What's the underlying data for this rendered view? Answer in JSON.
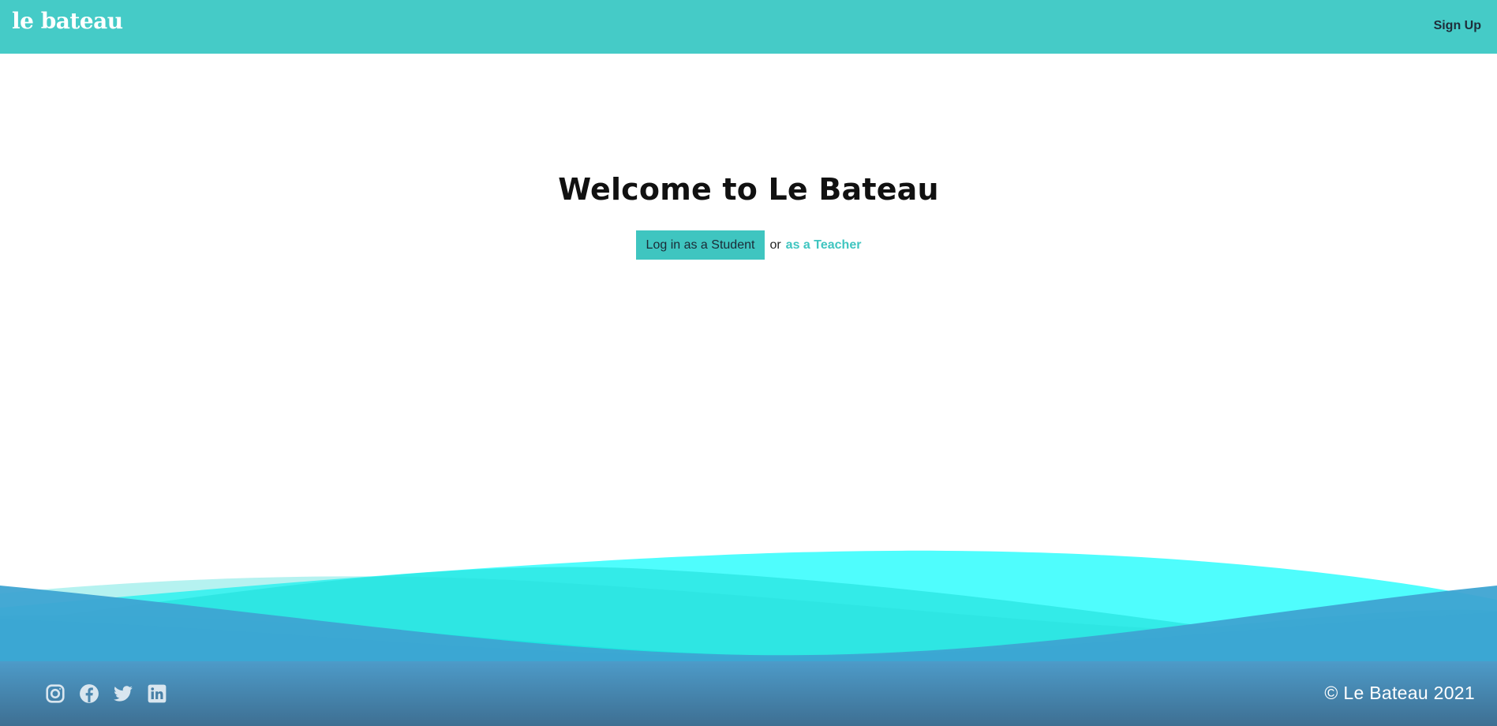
{
  "header": {
    "brand": "le bateau",
    "signup_label": "Sign Up"
  },
  "hero": {
    "title": "Welcome to Le Bateau",
    "student_button_label": "Log in as a Student",
    "or_text": "or",
    "teacher_link_label": "as a Teacher"
  },
  "footer": {
    "socials": [
      {
        "icon": "instagram-icon"
      },
      {
        "icon": "facebook-icon"
      },
      {
        "icon": "twitter-icon"
      },
      {
        "icon": "linkedin-icon"
      }
    ],
    "copyright": "© Le Bateau 2021"
  },
  "colors": {
    "brand_teal": "#45cbc7",
    "button_teal": "#3fc5c0",
    "wave_cyan": "#4ffdfd",
    "wave_teal": "#1ee5e1",
    "wave_blue": "#3ea4d2",
    "footer_top": "#4d9bc9",
    "footer_bottom": "#3e6f92"
  }
}
